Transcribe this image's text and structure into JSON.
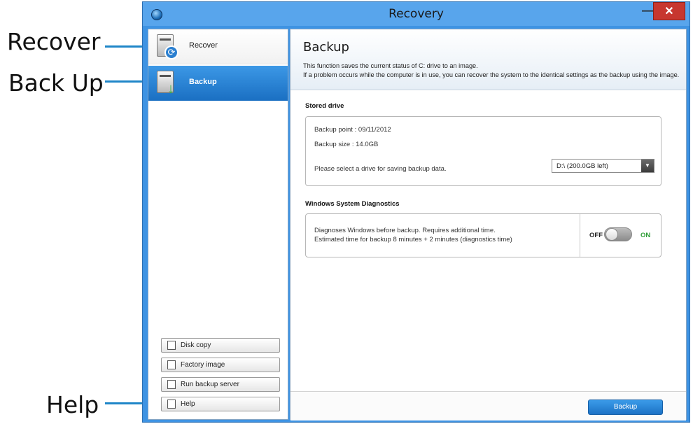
{
  "window": {
    "title": "Recovery",
    "minimize_glyph": "—",
    "close_glyph": "✕",
    "accent_color": "#3e93e3",
    "close_color": "#c7372f"
  },
  "callouts": {
    "recover": "Recover",
    "backup": "Back Up",
    "help": "Help",
    "line_color": "#1f86c8"
  },
  "sidebar": {
    "items": [
      {
        "label": "Recover",
        "icon": "recover-disk-icon",
        "selected": false
      },
      {
        "label": "Backup",
        "icon": "backup-disk-icon",
        "selected": true
      }
    ],
    "buttons": [
      {
        "label": "Disk copy",
        "icon": "disk-copy-icon"
      },
      {
        "label": "Factory image",
        "icon": "factory-image-icon"
      },
      {
        "label": "Run backup server",
        "icon": "backup-server-icon"
      },
      {
        "label": "Help",
        "icon": "help-icon"
      }
    ]
  },
  "main": {
    "title": "Backup",
    "description_line1": "This function saves the current status of C: drive to an image.",
    "description_line2": "If a problem occurs while the computer is in use, you can recover the system to the identical settings as the backup using the image.",
    "stored_drive": {
      "title": "Stored drive",
      "backup_point": "Backup point : 09/11/2012",
      "backup_size": "Backup size : 14.0GB",
      "select_prompt": "Please select a drive for saving backup data.",
      "drive_selected": "D:\\ (200.0GB left)"
    },
    "diagnostics": {
      "title": "Windows System Diagnostics",
      "line1": "Diagnoses Windows before backup. Requires additional time.",
      "line2": "Estimated time for backup 8 minutes + 2 minutes (diagnostics time)",
      "off_label": "OFF",
      "on_label": "ON",
      "toggle_state": "off"
    },
    "action_button": "Backup"
  }
}
